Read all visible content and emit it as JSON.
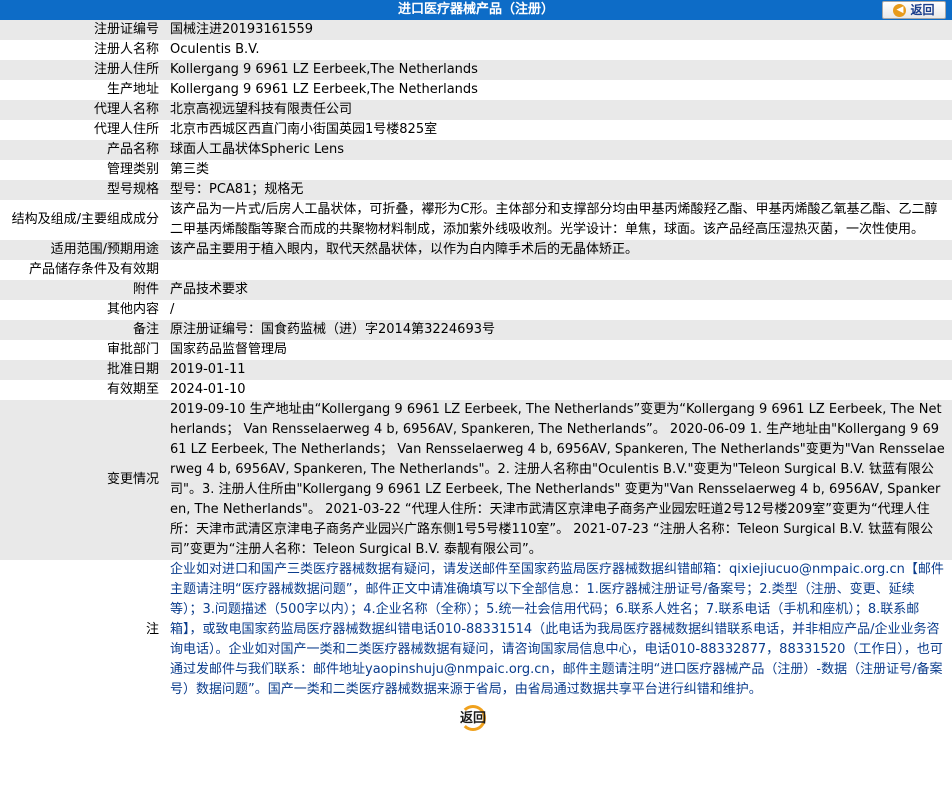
{
  "header": {
    "title": "进口医疗器械产品（注册）",
    "back_label": "返回"
  },
  "rows": [
    {
      "label": "注册证编号",
      "value": "国械注进20193161559"
    },
    {
      "label": "注册人名称",
      "value": "Oculentis B.V."
    },
    {
      "label": "注册人住所",
      "value": "Kollergang 9 6961 LZ Eerbeek,The Netherlands"
    },
    {
      "label": "生产地址",
      "value": "Kollergang 9 6961 LZ Eerbeek,The Netherlands"
    },
    {
      "label": "代理人名称",
      "value": "北京高视远望科技有限责任公司"
    },
    {
      "label": "代理人住所",
      "value": "北京市西城区西直门南小街国英园1号楼825室"
    },
    {
      "label": "产品名称",
      "value": "球面人工晶状体Spheric Lens"
    },
    {
      "label": "管理类别",
      "value": "第三类"
    },
    {
      "label": "型号规格",
      "value": "型号：PCA81；规格无"
    },
    {
      "label": "结构及组成/主要组成成分",
      "value": "该产品为一片式/后房人工晶状体，可折叠，襻形为C形。主体部分和支撑部分均由甲基丙烯酸羟乙酯、甲基丙烯酸乙氧基乙酯、乙二醇二甲基丙烯酸酯等聚合而成的共聚物材料制成，添加紫外线吸收剂。光学设计：单焦，球面。该产品经高压湿热灭菌，一次性使用。"
    },
    {
      "label": "适用范围/预期用途",
      "value": "该产品主要用于植入眼内，取代天然晶状体，以作为白内障手术后的无晶体矫正。"
    },
    {
      "label": "产品储存条件及有效期",
      "value": ""
    },
    {
      "label": "附件",
      "value": "产品技术要求"
    },
    {
      "label": "其他内容",
      "value": "/"
    },
    {
      "label": "备注",
      "value": "原注册证编号：国食药监械（进）字2014第3224693号"
    },
    {
      "label": "审批部门",
      "value": "国家药品监督管理局"
    },
    {
      "label": "批准日期",
      "value": "2019-01-11"
    },
    {
      "label": "有效期至",
      "value": "2024-01-10"
    },
    {
      "label": "变更情况",
      "value": "2019-09-10 生产地址由“Kollergang 9 6961 LZ Eerbeek, The Netherlands”变更为“Kollergang 9 6961 LZ Eerbeek, The Netherlands； Van Rensselaerweg 4 b, 6956AV, Spankeren, The Netherlands”。 2020-06-09 1. 生产地址由\"Kollergang 9 6961 LZ Eerbeek, The Netherlands； Van Rensselaerweg 4 b, 6956AV, Spankeren, The Netherlands\"变更为\"Van Rensselaerweg 4 b, 6956AV, Spankeren, The Netherlands\"。2. 注册人名称由\"Oculentis B.V.\"变更为\"Teleon Surgical B.V. 钛蓝有限公司\"。3. 注册人住所由\"Kollergang 9 6961 LZ Eerbeek, The Netherlands\" 变更为\"Van Rensselaerweg 4 b, 6956AV, Spankeren, The Netherlands\"。 2021-03-22 “代理人住所：天津市武清区京津电子商务产业园宏旺道2号12号楼209室”变更为“代理人住所：天津市武清区京津电子商务产业园兴广路东侧1号5号楼110室”。 2021-07-23 “注册人名称：Teleon Surgical B.V. 钛蓝有限公司”变更为“注册人名称：Teleon Surgical B.V. 泰靓有限公司”。"
    },
    {
      "label": "注",
      "value": "企业如对进口和国产三类医疗器械数据有疑问，请发送邮件至国家药监局医疗器械数据纠错邮箱：qixiejiucuo@nmpaic.org.cn【邮件主题请注明“医疗器械数据问题”，邮件正文中请准确填写以下全部信息：1.医疗器械注册证号/备案号；2.类型（注册、变更、延续等）；3.问题描述（500字以内）；4.企业名称（全称）；5.统一社会信用代码；6.联系人姓名；7.联系电话（手机和座机）；8.联系邮箱】，或致电国家药监局医疗器械数据纠错电话010-88331514（此电话为我局医疗器械数据纠错联系电话，并非相应产品/企业业务咨询电话）。企业如对国产一类和二类医疗器械数据有疑问，请咨询国家局信息中心，电话010-88332877，88331520（工作日），也可通过发邮件与我们联系：邮件地址yaopinshuju@nmpaic.org.cn，邮件主题请注明“进口医疗器械产品（注册）-数据（注册证号/备案号）数据问题”。国产一类和二类医疗器械数据来源于省局，由省局通过数据共享平台进行纠错和维护。"
    }
  ],
  "footer": {
    "back_label": "返回"
  }
}
